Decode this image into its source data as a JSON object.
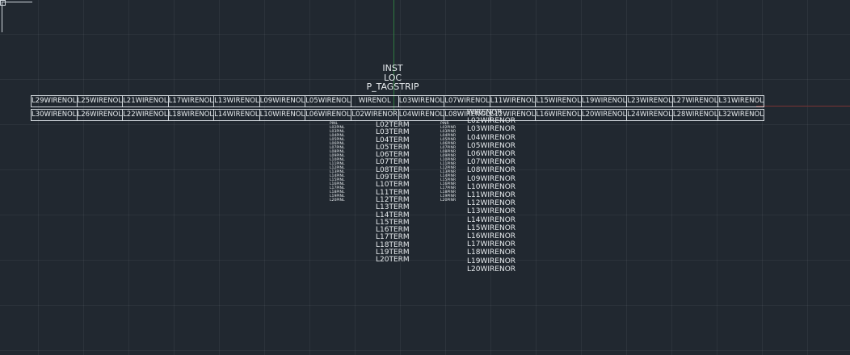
{
  "block": {
    "inst": "INST",
    "loc": "LOC",
    "tag": "P_TAGSTRIP"
  },
  "strip": {
    "top_row": [
      "L29WIRENOL",
      "L25WIRENOL",
      "L21WIRENOL",
      "L17WIRENOL",
      "L13WIRENOL",
      "L09WIRENOL",
      "L05WIRENOL",
      "WIRENOL",
      "L03WIRENOL",
      "L07WIRENOL",
      "L11WIRENOL",
      "L15WIRENOL",
      "L19WIRENOL",
      "L23WIRENOL",
      "L27WIRENOL",
      "L31WIRENOL"
    ],
    "bottom_row": [
      "L30WIRENOL",
      "L26WIRENOL",
      "L22WIRENOL",
      "L18WIRENOL",
      "L14WIRENOL",
      "L10WIRENOL",
      "L06WIRENOL",
      "L02WIRENOR",
      "L04WIRENOL",
      "L08WIRENOL",
      "L12WIRENOL",
      "L16WIRENOL",
      "L20WIRENOL",
      "L24WIRENOL",
      "L28WIRENOL",
      "L32WIRENOL"
    ]
  },
  "pin_left": [
    "PINL",
    "L02PINL",
    "L03PINL",
    "L04PINL",
    "L05PINL",
    "L06PINL",
    "L07PINL",
    "L08PINL",
    "L09PINL",
    "L10PINL",
    "L11PINL",
    "L12PINL",
    "L13PINL",
    "L14PINL",
    "L15PINL",
    "L16PINL",
    "L17PINL",
    "L18PINL",
    "L19PINL",
    "L20PINL"
  ],
  "pin_right": [
    "PINR",
    "L02PINR",
    "L03PINR",
    "L04PINR",
    "L05PINR",
    "L06PINR",
    "L07PINR",
    "L08PINR",
    "L09PINR",
    "L10PINR",
    "L11PINR",
    "L12PINR",
    "L13PINR",
    "L14PINR",
    "L15PINR",
    "L16PINR",
    "L17PINR",
    "L18PINR",
    "L19PINR",
    "L20PINR"
  ],
  "terms": [
    "L02TERM",
    "L03TERM",
    "L04TERM",
    "L05TERM",
    "L06TERM",
    "L07TERM",
    "L08TERM",
    "L09TERM",
    "L10TERM",
    "L11TERM",
    "L12TERM",
    "L13TERM",
    "L14TERM",
    "L15TERM",
    "L16TERM",
    "L17TERM",
    "L18TERM",
    "L19TERM",
    "L20TERM"
  ],
  "wirenor": [
    "WIRENOR",
    "L02WIRENOR",
    "L03WIRENOR",
    "L04WIRENOR",
    "L05WIRENOR",
    "L06WIRENOR",
    "L07WIRENOR",
    "L08WIRENOR",
    "L09WIRENOR",
    "L10WIRENOR",
    "L11WIRENOR",
    "L12WIRENOR",
    "L13WIRENOR",
    "L14WIRENOR",
    "L15WIRENOR",
    "L16WIRENOR",
    "L17WIRENOR",
    "L18WIRENOR",
    "L19WIRENOR",
    "L20WIRENOR"
  ],
  "colors": {
    "background": "#212830",
    "text": "#e7ebee",
    "y_axis": "#2f7a3f",
    "x_axis": "#7a3333"
  }
}
